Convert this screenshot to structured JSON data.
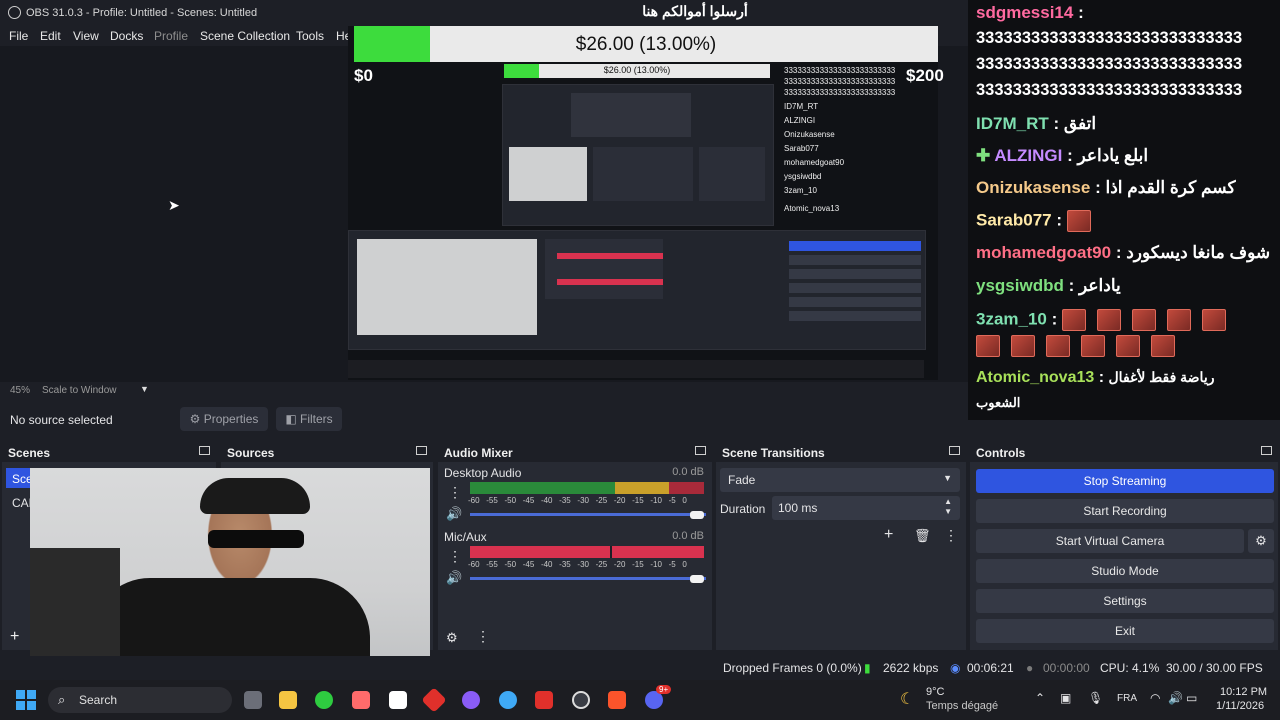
{
  "window": {
    "title": "OBS 31.0.3 - Profile: Untitled - Scenes: Untitled"
  },
  "menu": [
    "File",
    "Edit",
    "View",
    "Docks",
    "Profile",
    "Scene Collection",
    "Tools",
    "Hel"
  ],
  "donation": {
    "title": "أرسلوا أموالكم هنا",
    "amount_text": "$26.00 (13.00%)",
    "progress": 0.13,
    "min": "$0",
    "max": "$200"
  },
  "chat": [
    {
      "user": "sdgmessi14",
      "color": "#ff6aa0",
      "msg": ""
    },
    {
      "user": "",
      "color": "#ffffff",
      "msg": "33333333333333333333333333333"
    },
    {
      "user": "",
      "color": "#ffffff",
      "msg": "33333333333333333333333333333"
    },
    {
      "user": "",
      "color": "#ffffff",
      "msg": "33333333333333333333333333333"
    },
    {
      "user": "ID7M_RT",
      "color": "#7fe0b0",
      "msg": "اتفق"
    },
    {
      "user": "ALZINGI",
      "color": "#c58bff",
      "msg": "ابلع ياداعر"
    },
    {
      "user": "Onizukasense",
      "color": "#f5c98a",
      "msg": "كسم كرة القدم اذا"
    },
    {
      "user": "Sarab077",
      "color": "#ffe9a8",
      "msg": ""
    },
    {
      "user": "mohamedgoat90",
      "color": "#ff6f86",
      "msg": "شوف مانغا ديسكورد"
    },
    {
      "user": "ysgsiwdbd",
      "color": "#7fe07f",
      "msg": "ياداعر"
    },
    {
      "user": "3zam_10",
      "color": "#7fe0b0",
      "msg": ""
    },
    {
      "user": "Atomic_nova13",
      "color": "#a8e05a",
      "msg": "رياضة فقط لأغفال"
    },
    {
      "user": "",
      "color": "#ffffff",
      "msg": "الشعوب"
    }
  ],
  "preview": {
    "zoom": "45%",
    "scale_mode": "Scale to Window"
  },
  "properties": {
    "no_source": "No source selected",
    "properties_label": "Properties",
    "filters_label": "Filters"
  },
  "docks": {
    "scenes": {
      "title": "Scenes",
      "items": [
        "Sce",
        "CAM"
      ]
    },
    "sources": {
      "title": "Sources"
    },
    "audio_mixer": {
      "title": "Audio Mixer",
      "ticks": [
        "-60",
        "-55",
        "-50",
        "-45",
        "-40",
        "-35",
        "-30",
        "-25",
        "-20",
        "-15",
        "-10",
        "-5",
        "0"
      ],
      "channels": [
        {
          "name": "Desktop Audio",
          "db": "0.0 dB",
          "level": 1.0
        },
        {
          "name": "Mic/Aux",
          "db": "0.0 dB",
          "level": 1.0
        }
      ]
    },
    "transitions": {
      "title": "Scene Transitions",
      "transition": "Fade",
      "duration_label": "Duration",
      "duration_value": "100 ms"
    },
    "controls": {
      "title": "Controls",
      "buttons": [
        "Stop Streaming",
        "Start Recording",
        "Start Virtual Camera",
        "Studio Mode",
        "Settings",
        "Exit"
      ]
    }
  },
  "status": {
    "dropped": "Dropped Frames 0 (0.0%)",
    "kbps": "2622 kbps",
    "stream_time": "00:06:21",
    "rec_time": "00:00:00",
    "cpu": "CPU: 4.1%",
    "fps": "30.00 / 30.00 FPS"
  },
  "taskbar": {
    "search": "Search",
    "weather_temp": "9°C",
    "weather_desc": "Temps dégagé",
    "lang": "FRA",
    "time": "10:12 PM",
    "date": "1/11/2026",
    "badge": "9+"
  },
  "colors": {
    "accent": "#2f55e0",
    "green": "#3ddc3d",
    "meter_red": "#d9324f"
  }
}
